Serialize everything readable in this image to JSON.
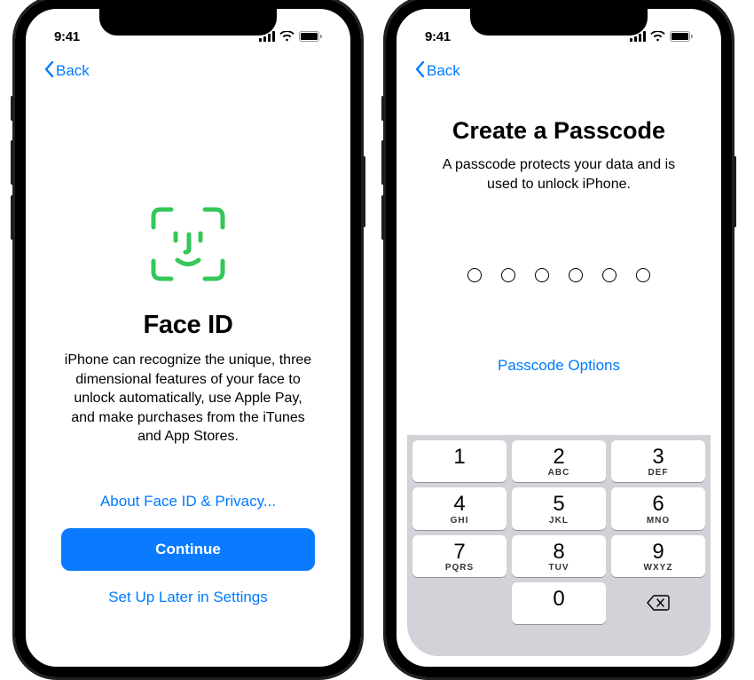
{
  "status": {
    "time": "9:41"
  },
  "nav": {
    "back": "Back"
  },
  "faceid": {
    "title": "Face ID",
    "description": "iPhone can recognize the unique, three dimensional features of your face to unlock automatically, use Apple Pay, and make purchases from the iTunes and App Stores.",
    "about_link": "About Face ID & Privacy...",
    "continue": "Continue",
    "later": "Set Up Later in Settings"
  },
  "passcode": {
    "title": "Create a Passcode",
    "description": "A passcode protects your data and is used to unlock iPhone.",
    "digits": 6,
    "options": "Passcode Options"
  },
  "keypad": {
    "keys": [
      {
        "num": "1",
        "let": ""
      },
      {
        "num": "2",
        "let": "ABC"
      },
      {
        "num": "3",
        "let": "DEF"
      },
      {
        "num": "4",
        "let": "GHI"
      },
      {
        "num": "5",
        "let": "JKL"
      },
      {
        "num": "6",
        "let": "MNO"
      },
      {
        "num": "7",
        "let": "PQRS"
      },
      {
        "num": "8",
        "let": "TUV"
      },
      {
        "num": "9",
        "let": "WXYZ"
      },
      {
        "num": "0",
        "let": ""
      }
    ]
  },
  "colors": {
    "accent": "#007aff",
    "primary_button": "#0a7aff",
    "faceid_green": "#35c759"
  }
}
